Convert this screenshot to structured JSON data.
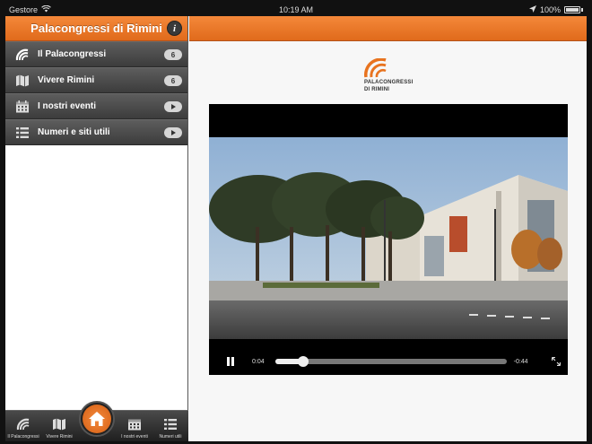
{
  "status_bar": {
    "carrier": "Gestore",
    "time": "10:19 AM",
    "battery": "100%"
  },
  "sidebar": {
    "title": "Palacongressi di Rimini",
    "info_label": "i",
    "items": [
      {
        "label": "Il Palacongressi",
        "badge": "6",
        "icon": "palacongressi-logo-icon"
      },
      {
        "label": "Vivere Rimini",
        "badge": "6",
        "icon": "map-icon"
      },
      {
        "label": "I nostri eventi",
        "badge": "",
        "icon": "calendar-icon"
      },
      {
        "label": "Numeri e siti utili",
        "badge": "",
        "icon": "list-icon"
      }
    ]
  },
  "tabbar": {
    "tabs": [
      {
        "label": "Il Palacongressi",
        "icon": "palacongressi-logo-icon"
      },
      {
        "label": "Vivere Rimini",
        "icon": "map-icon"
      },
      {
        "label": "",
        "icon": "home-icon"
      },
      {
        "label": "I nostri eventi",
        "icon": "calendar-icon"
      },
      {
        "label": "Numeri utili",
        "icon": "list-icon"
      }
    ]
  },
  "content": {
    "logo_line1": "PALACONGRESSI",
    "logo_line2": "DI RIMINI",
    "video": {
      "current_time": "0:04",
      "remaining_time": "-0:44",
      "progress": 0.12
    }
  },
  "colors": {
    "accent": "#e8731f",
    "menu_bg": "#4a4a4a"
  }
}
